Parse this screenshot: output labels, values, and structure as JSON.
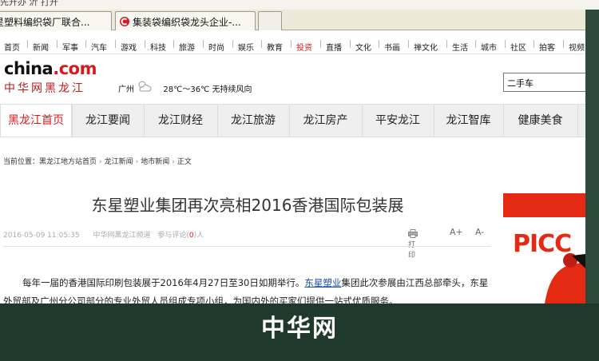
{
  "browser": {
    "top_strip_text": "先开办 沂 打开",
    "tabs": [
      {
        "label": "星塑料编织袋厂联合..."
      },
      {
        "label": "集装袋编织袋龙头企业-..."
      },
      {
        "label": ""
      }
    ]
  },
  "site_nav": {
    "links": [
      "首页",
      "新闻",
      "军事",
      "汽车",
      "游戏",
      "科技",
      "旅游",
      "时尚",
      "娱乐",
      "教育",
      "投资",
      "直播",
      "文化",
      "书画",
      "禅文化",
      "生活",
      "城市",
      "社区",
      "拍客",
      "视频"
    ],
    "highlight": "投资"
  },
  "header": {
    "logo_main": "china",
    "logo_dot_com": ".com",
    "logo_sub": "中华网黑龙江",
    "city": "广州",
    "weather": "28℃～36℃  无持续风向",
    "search_value": "二手车"
  },
  "channels": [
    "黑龙江首页",
    "龙江要闻",
    "龙江财经",
    "龙江旅游",
    "龙江房产",
    "平安龙江",
    "龙江智库",
    "健康美食",
    "得"
  ],
  "breadcrumb": {
    "prefix": "当前位置：",
    "items": [
      "黑龙江地方站首页",
      "龙江新闻",
      "地市新闻",
      "正文"
    ],
    "separator": "›"
  },
  "article": {
    "title": "东星塑业集团再次亮相2016香港国际包装展",
    "date": "2016-05-09 11:05:35",
    "source": "中华网黑龙江频道",
    "comments_prefix": "参与评论(",
    "comments_count": "0",
    "comments_suffix": ")人",
    "print_label": "打印",
    "font_increase": "A+",
    "font_decrease": "A-",
    "para_part1": "每年一届的香港国际印刷包装展于2016年4月27日至30日如期举行。",
    "para_link": "东星塑业",
    "para_part2": "集团此次参展由江西总部牵头，东星外贸部及广州分公司部分的专业外贸人员组成专项小组，为国内外的买家们提供一站式优质服务。"
  },
  "ad": {
    "brand": "PICC"
  },
  "caption": "中华网",
  "colors": {
    "accent": "#d71a20",
    "caption_bg": "#1f3a2c",
    "ad_red": "#e52a14"
  }
}
